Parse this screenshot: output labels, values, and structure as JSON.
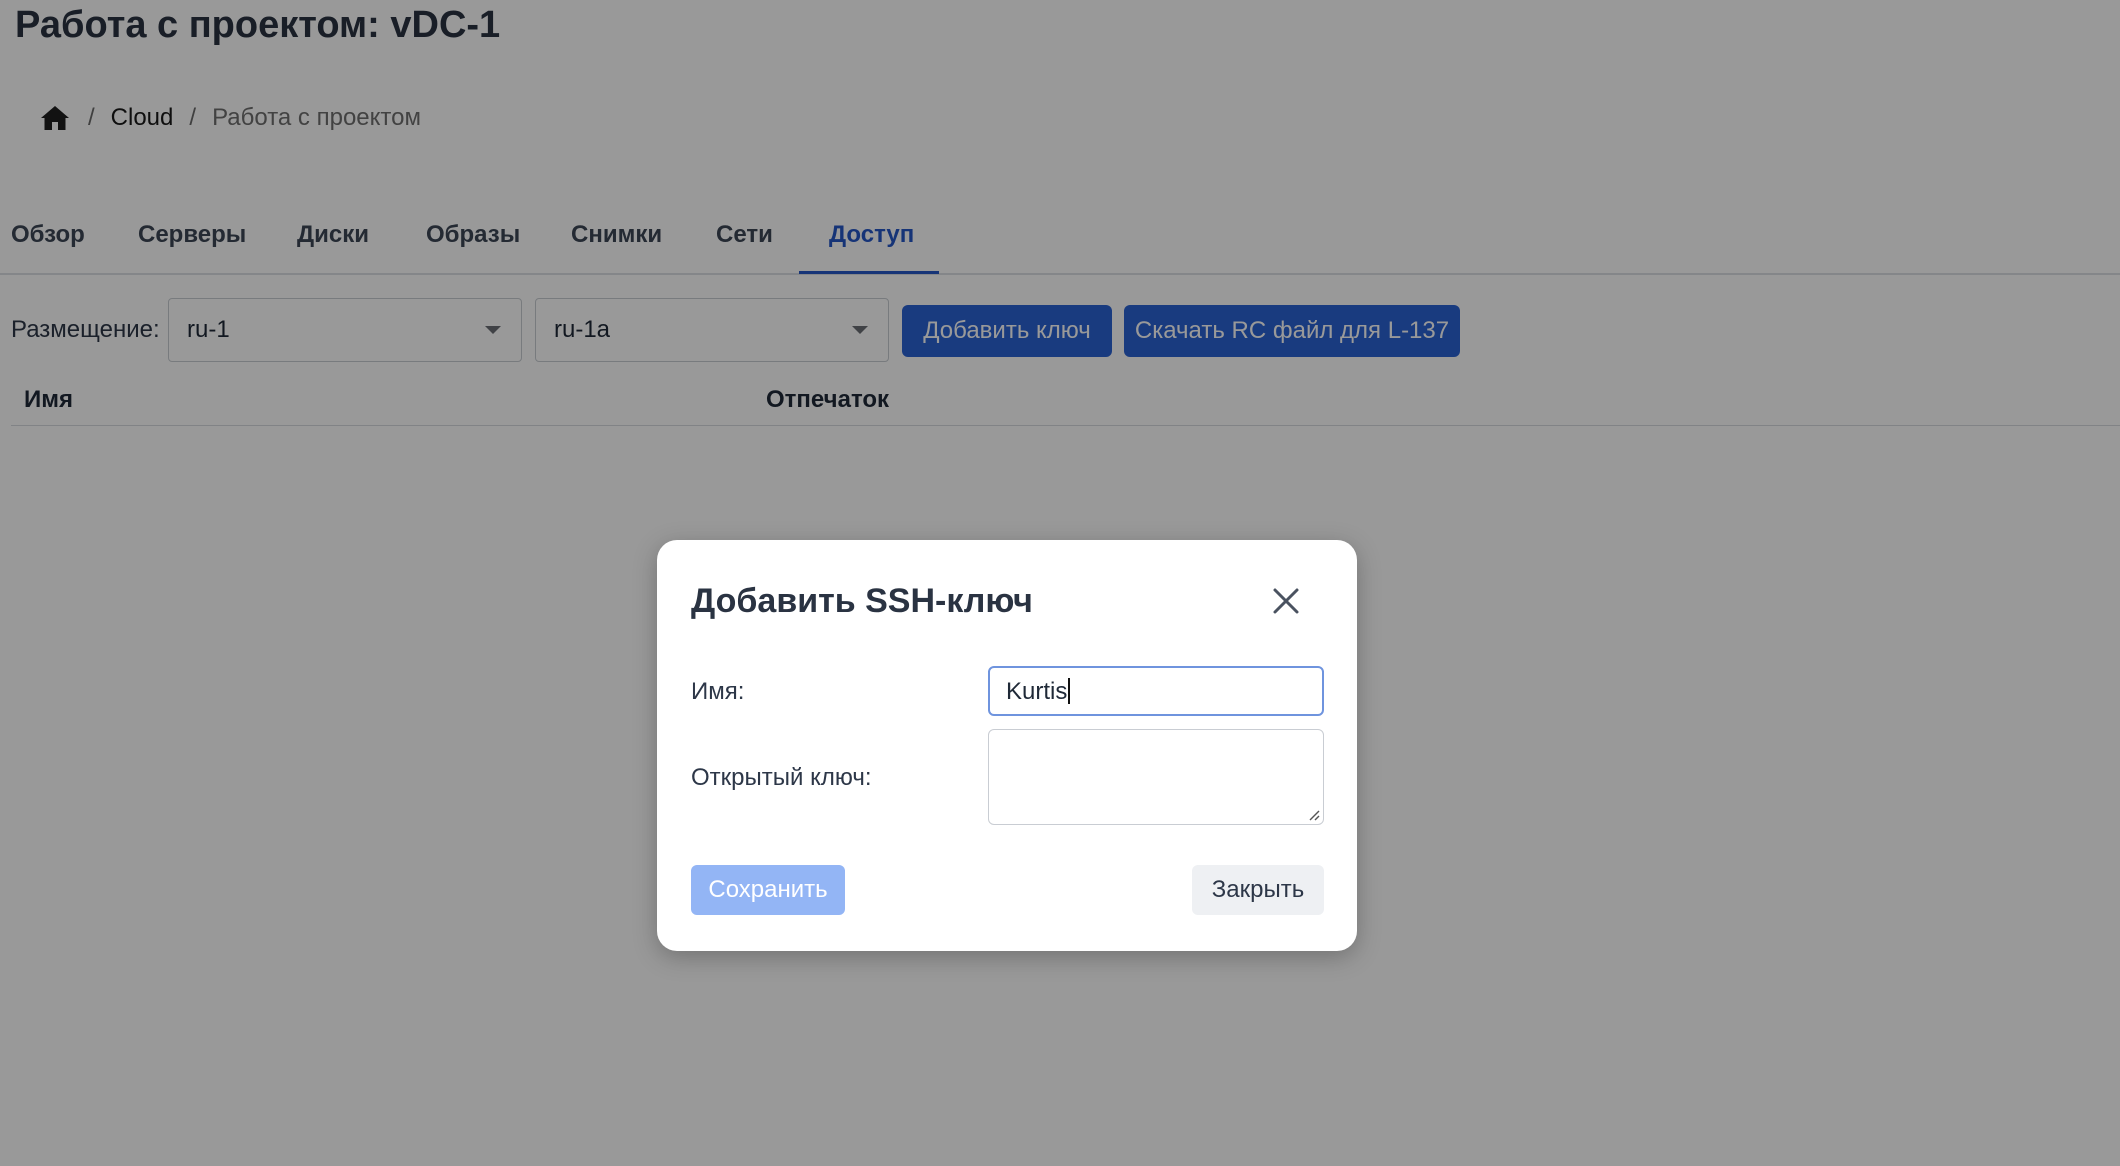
{
  "page": {
    "title": "Работа с проектом: vDC-1"
  },
  "breadcrumb": {
    "home_icon": "home-icon",
    "separator": "/",
    "items": [
      "Cloud",
      "Работа с проектом"
    ]
  },
  "tabs": {
    "items": [
      "Обзор",
      "Серверы",
      "Диски",
      "Образы",
      "Снимки",
      "Сети",
      "Доступ"
    ],
    "active": "Доступ"
  },
  "toolbar": {
    "placement_label": "Размещение:",
    "region_select": "ru-1",
    "zone_select": "ru-1a",
    "add_key_button": "Добавить ключ",
    "download_rc_button": "Скачать RC файл для L-137"
  },
  "table": {
    "columns": [
      "Имя",
      "Отпечаток"
    ],
    "rows": []
  },
  "modal": {
    "title": "Добавить SSH-ключ",
    "name_label": "Имя:",
    "name_value": "Kurtis",
    "public_key_label": "Открытый ключ:",
    "public_key_value": "",
    "save_button": "Сохранить",
    "close_button": "Закрыть",
    "close_icon": "close-icon"
  },
  "colors": {
    "accent": "#2b63d4",
    "accent_disabled": "#93b5f5",
    "overlay": "rgba(0,0,0,0.4)"
  }
}
